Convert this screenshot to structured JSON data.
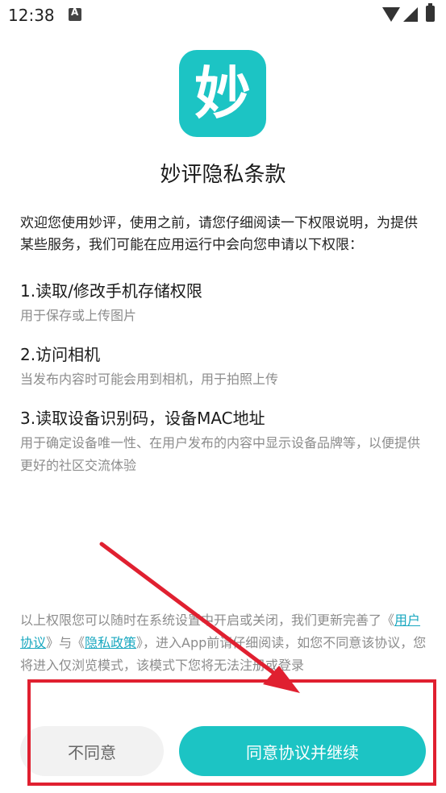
{
  "status_bar": {
    "time": "12:38",
    "icons": [
      "notification-icon",
      "wifi-icon",
      "signal-icon",
      "battery-icon"
    ]
  },
  "app": {
    "logo_glyph": "妙",
    "logo_color": "#1cc4c4"
  },
  "title": "妙评隐私条款",
  "intro": "欢迎您使用妙评，使用之前，请您仔细阅读一下权限说明，为提供某些服务，我们可能在应用运行中会向您申请以下权限：",
  "permissions": [
    {
      "title": "1.读取/修改手机存储权限",
      "desc": "用于保存或上传图片"
    },
    {
      "title": "2.访问相机",
      "desc": "当发布内容时可能会用到相机，用于拍照上传"
    },
    {
      "title": "3.读取设备识别码，设备MAC地址",
      "desc": "用于确定设备唯一性、在用户发布的内容中显示设备品牌等，以便提供更好的社区交流体验"
    }
  ],
  "footer": {
    "part1": "以上权限您可以随时在系统设置中开启或关闭，我们更新完善了《",
    "user_agreement": "用户协议",
    "part2": "》与《",
    "privacy_policy": "隐私政策",
    "part3": "》，进入App前请仔细阅读，如您不同意该协议，您将进入仅浏览模式，该模式下您将无法注册或登录"
  },
  "buttons": {
    "disagree": "不同意",
    "agree": "同意协议并继续"
  },
  "annotation_color": "#e02030"
}
